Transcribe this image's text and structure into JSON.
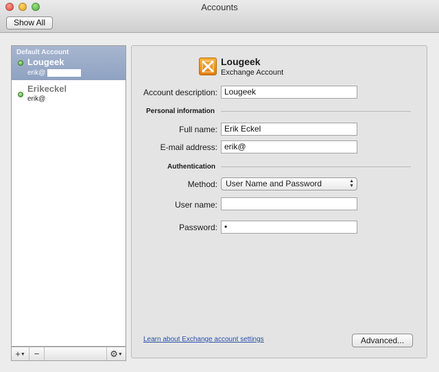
{
  "window": {
    "title": "Accounts"
  },
  "toolbar": {
    "show_all_label": "Show All"
  },
  "sidebar": {
    "default_label": "Default Account",
    "accounts": [
      {
        "name": "Lougeek",
        "email": "erik@",
        "status": "online",
        "selected": true
      },
      {
        "name": "Erikeckel",
        "email": "erik@",
        "status": "online",
        "selected": false
      }
    ],
    "footer": {
      "add_label": "+",
      "remove_label": "−",
      "gear_label": "⚙"
    }
  },
  "account": {
    "name": "Lougeek",
    "type": "Exchange Account",
    "description_label": "Account description:",
    "description_value": "Lougeek",
    "personal_section": "Personal information",
    "full_name_label": "Full name:",
    "full_name_value": "Erik Eckel",
    "email_label": "E-mail address:",
    "email_value": "erik@",
    "auth_section": "Authentication",
    "method_label": "Method:",
    "method_value": "User Name and Password",
    "username_label": "User name:",
    "username_value": "",
    "password_label": "Password:",
    "password_value": "•",
    "learn_link": "Learn about Exchange account settings",
    "advanced_label": "Advanced..."
  },
  "colors": {
    "selection": "#98a9c7",
    "status_online": "#3e9a2c",
    "exchange_icon": "#f0961f",
    "link": "#2a4ea8"
  }
}
